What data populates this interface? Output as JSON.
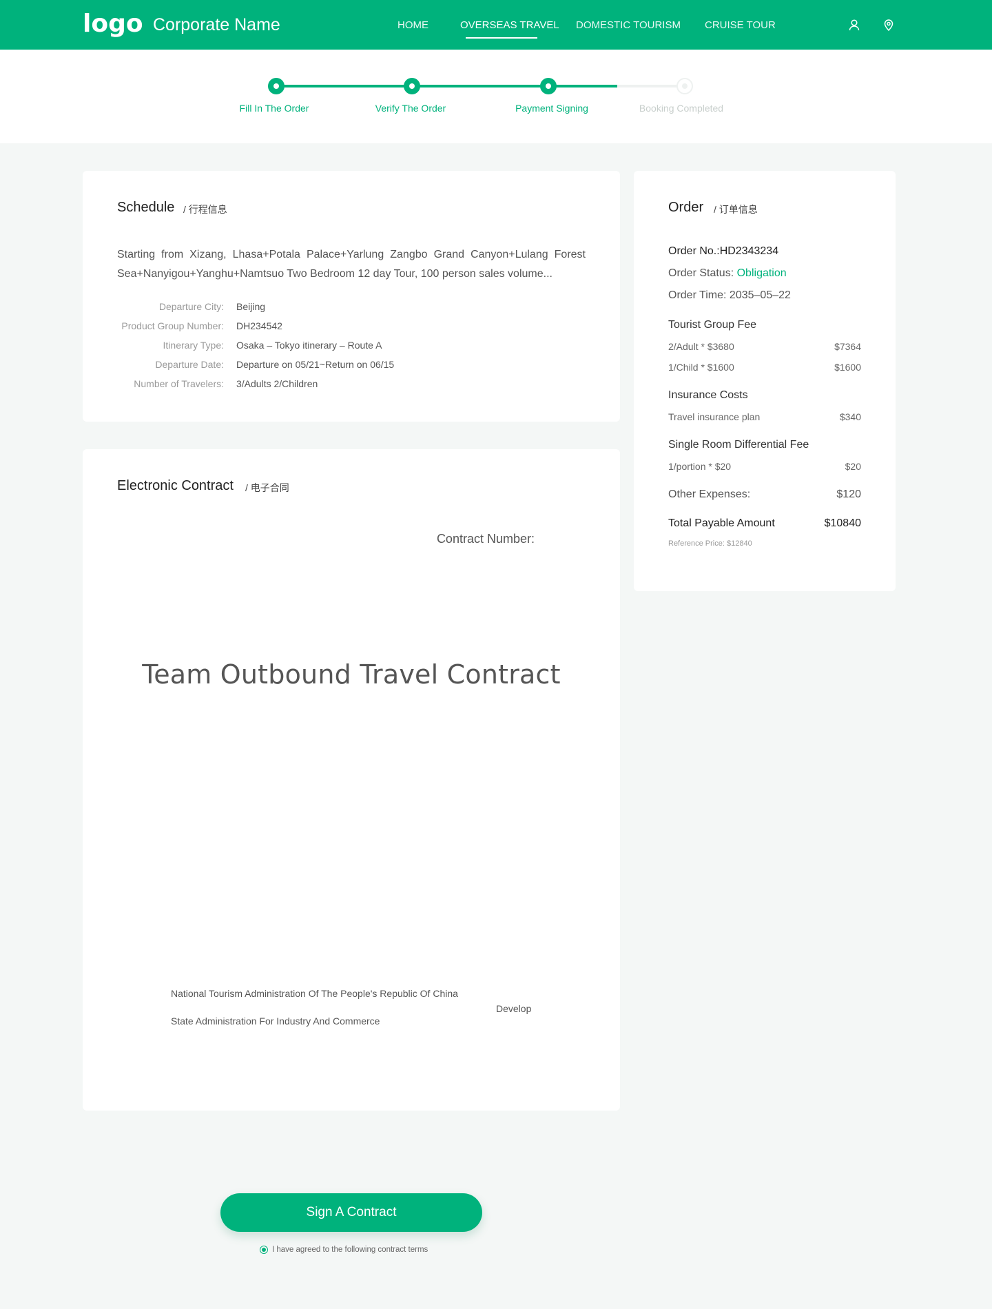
{
  "header": {
    "logo": "logo",
    "company": "Corporate Name",
    "nav": [
      {
        "label": "HOME"
      },
      {
        "label": "OVERSEAS TRAVEL"
      },
      {
        "label": "DOMESTIC TOURISM"
      },
      {
        "label": "CRUISE TOUR"
      }
    ],
    "active_nav": "OVERSEAS TRAVEL",
    "icons": [
      "user-icon",
      "location-pin-icon"
    ]
  },
  "steps": [
    {
      "label": "Fill In The Order",
      "status": "done"
    },
    {
      "label": "Verify The Order",
      "status": "done"
    },
    {
      "label": "Payment Signing",
      "status": "current"
    },
    {
      "label": "Booking Completed",
      "status": "pending"
    }
  ],
  "schedule": {
    "title": "Schedule",
    "subtitle": "/ 行程信息",
    "description": "Starting from Xizang, Lhasa+Potala Palace+Yarlung Zangbo Grand Canyon+Lulang Forest Sea+Nanyigou+Yanghu+Namtsuo Two Bedroom 12 day Tour, 100 person sales volume...",
    "rows": [
      {
        "label": "Departure City:",
        "value": "Beijing"
      },
      {
        "label": "Product Group Number:",
        "value": "DH234542"
      },
      {
        "label": "Itinerary Type:",
        "value": "Osaka – Tokyo itinerary – Route A"
      },
      {
        "label": "Departure Date:",
        "value": "Departure on 05/21~Return on 06/15"
      },
      {
        "label": "Number of Travelers:",
        "value": "3/Adults 2/Children"
      }
    ]
  },
  "contract": {
    "title": "Electronic Contract",
    "subtitle": "/ 电子合同",
    "number_label": "Contract Number:",
    "heading": "Team Outbound Travel Contract",
    "issuer_1": "National Tourism Administration Of The People's Republic Of China",
    "issuer_2": "State Administration For Industry And Commerce",
    "develop": "Develop"
  },
  "order": {
    "title": "Order",
    "subtitle": "/ 订单信息",
    "order_no_label": "Order No.:",
    "order_no": "HD2343234",
    "status_label": "Order Status:",
    "status": "Obligation",
    "time_label": "Order Time:",
    "time": "2035–05–22",
    "group_fee_title": "Tourist Group Fee",
    "group_fee_items": [
      {
        "label": "2/Adult * $3680",
        "amount": "$7364"
      },
      {
        "label": "1/Child * $1600",
        "amount": "$1600"
      }
    ],
    "insurance_title": "Insurance Costs",
    "insurance_item": {
      "label": "Travel insurance plan",
      "amount": "$340"
    },
    "single_room_title": "Single Room Differential Fee",
    "single_room_item": {
      "label": "1/portion * $20",
      "amount": "$20"
    },
    "other_label": "Other Expenses:",
    "other_amount": "$120",
    "total_label": "Total Payable Amount",
    "total_amount": "$10840",
    "reference": "Reference Price: $12840"
  },
  "actions": {
    "sign_button": "Sign A Contract",
    "agree_text": "I have agreed to the following contract terms"
  },
  "colors": {
    "accent": "#00b27c",
    "background": "#f4f7f6"
  }
}
